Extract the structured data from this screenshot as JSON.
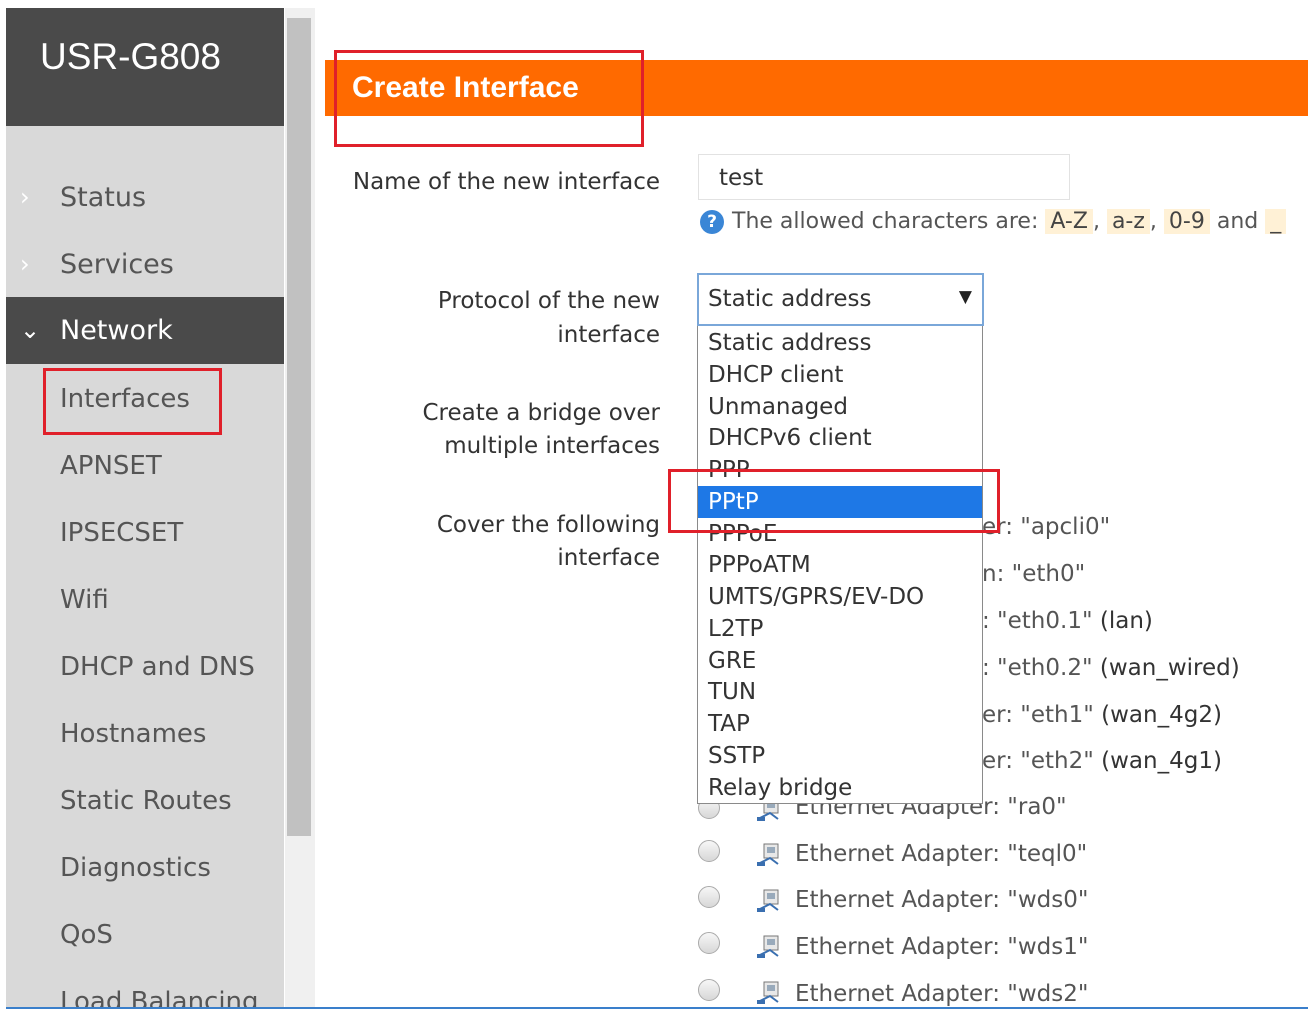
{
  "app": {
    "brand": "USR-G808"
  },
  "sidebar": {
    "top_items": [
      {
        "label": "Status",
        "chevron": "›"
      },
      {
        "label": "Services",
        "chevron": "›"
      }
    ],
    "active_section": {
      "label": "Network",
      "chevron": "⌄"
    },
    "sub_items": [
      {
        "label": "Interfaces"
      },
      {
        "label": "APNSET"
      },
      {
        "label": "IPSECSET"
      },
      {
        "label": "Wifi"
      },
      {
        "label": "DHCP and DNS"
      },
      {
        "label": "Hostnames"
      },
      {
        "label": "Static Routes"
      },
      {
        "label": "Diagnostics"
      },
      {
        "label": "QoS"
      },
      {
        "label": "Load Balancing"
      }
    ]
  },
  "header": {
    "title": "Create Interface"
  },
  "form": {
    "name_label": "Name of the new interface",
    "name_value": "test",
    "hint": {
      "prefix": "The allowed characters are:",
      "codes": [
        "A-Z",
        "a-z",
        "0-9",
        "_"
      ],
      "separator": ",",
      "and": "and"
    },
    "protocol_label_line1": "Protocol of the new",
    "protocol_label_line2": "interface",
    "protocol_selected": "Static address",
    "bridge_label_line1": "Create a bridge over",
    "bridge_label_line2": "multiple interfaces",
    "cover_label_line1": "Cover the following",
    "cover_label_line2": "interface"
  },
  "dropdown": {
    "options": [
      "Static address",
      "DHCP client",
      "Unmanaged",
      "DHCPv6 client",
      "PPP",
      "PPtP",
      "PPPoE",
      "PPPoATM",
      "UMTS/GPRS/EV-DO",
      "L2TP",
      "GRE",
      "TUN",
      "TAP",
      "SSTP",
      "Relay bridge"
    ],
    "highlighted": "PPtP"
  },
  "interfaces_partial": [
    {
      "text": "er: \"apcli0\"",
      "suffix": ""
    },
    {
      "text": "n: \"eth0\"",
      "suffix": ""
    },
    {
      "text": ": \"eth0.1\"",
      "suffix": "(lan)"
    },
    {
      "text": ": \"eth0.2\"",
      "suffix": "(wan_wired)"
    },
    {
      "text": "er: \"eth1\"",
      "suffix": "(wan_4g2)"
    },
    {
      "text": "er: \"eth2\"",
      "suffix": "(wan_4g1)"
    }
  ],
  "interfaces_full": [
    {
      "label": "Ethernet Adapter: \"ra0\""
    },
    {
      "label": "Ethernet Adapter: \"teql0\""
    },
    {
      "label": "Ethernet Adapter: \"wds0\""
    },
    {
      "label": "Ethernet Adapter: \"wds1\""
    },
    {
      "label": "Ethernet Adapter: \"wds2\""
    }
  ],
  "colors": {
    "accent": "#ff6a00",
    "sidebar_dark": "#4a4a4a",
    "sidebar_bg": "#d9d9d9",
    "highlight_red": "#e0202a",
    "selected_option": "#1e78e6"
  }
}
